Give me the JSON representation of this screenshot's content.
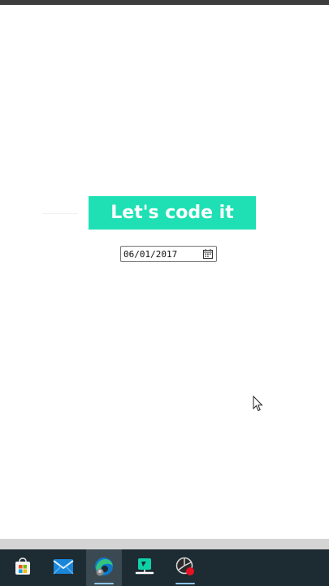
{
  "page": {
    "banner_text": "Let's code it",
    "banner_color": "#1ee0b4"
  },
  "date_input": {
    "value": "06/01/2017",
    "icon": "calendar-icon"
  },
  "taskbar": {
    "items": [
      {
        "name": "microsoft-store",
        "icon": "store-icon"
      },
      {
        "name": "mail",
        "icon": "mail-icon"
      },
      {
        "name": "edge",
        "icon": "edge-icon",
        "active": true
      },
      {
        "name": "filmora",
        "icon": "filmora-icon"
      },
      {
        "name": "screen-recorder",
        "icon": "recorder-icon"
      }
    ]
  }
}
